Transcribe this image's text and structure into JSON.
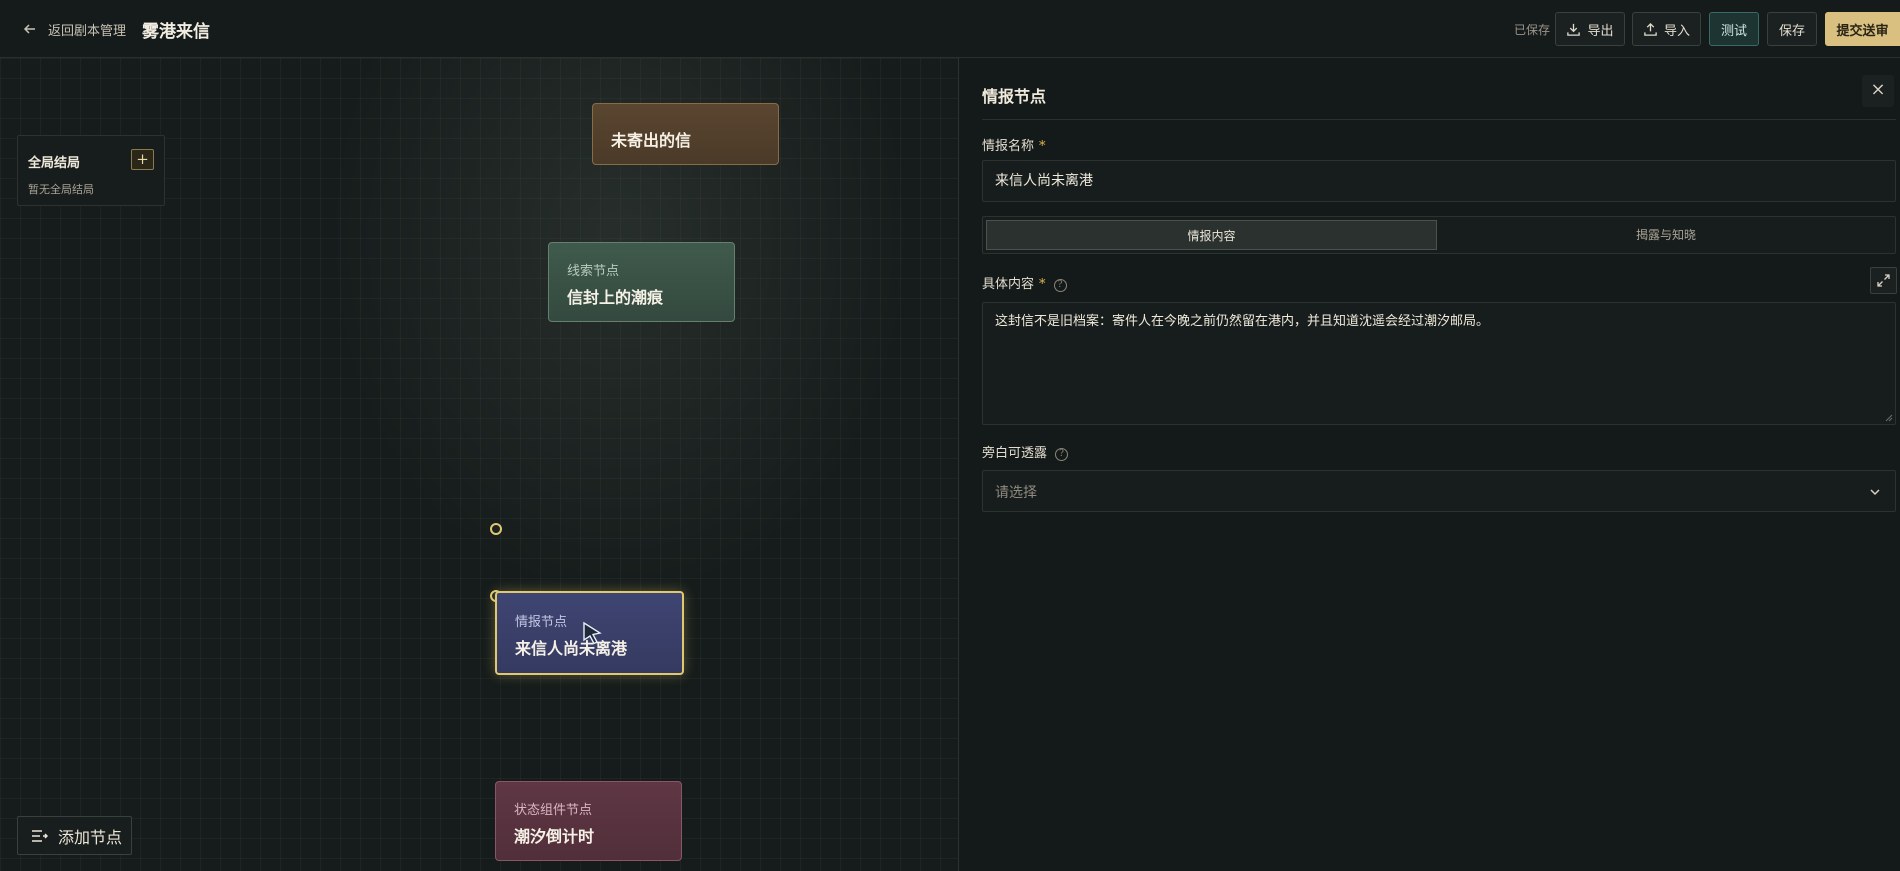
{
  "header": {
    "back_label": "返回剧本管理",
    "title": "雾港来信",
    "saved_status": "已保存",
    "export_label": "导出",
    "import_label": "导入",
    "test_label": "测试",
    "save_label": "保存",
    "submit_label": "提交送审"
  },
  "global_endings": {
    "title": "全局结局",
    "add_label": "+",
    "empty_text": "暂无全局结局"
  },
  "nodes": [
    {
      "type": "",
      "title": "未寄出的信",
      "color": "#5a4630"
    },
    {
      "type": "线索节点",
      "title": "信封上的潮痕",
      "color": "#3f5a4c"
    },
    {
      "type": "情报节点",
      "title": "来信人尚未离港",
      "color": "#3f4572",
      "selected": true
    },
    {
      "type": "状态组件节点",
      "title": "潮汐倒计时",
      "color": "#5f3744"
    }
  ],
  "add_node_label": "添加节点",
  "panel": {
    "title": "情报节点",
    "close_icon": "×",
    "name_label": "情报名称",
    "required_mark": "*",
    "name_value": "来信人尚未离港",
    "tabs": [
      "情报内容",
      "揭露与知晓"
    ],
    "content_label": "具体内容",
    "content_value": "这封信不是旧档案：寄件人在今晚之前仍然留在港内，并且知道沈遥会经过潮汐邮局。",
    "reveal_label": "旁白可透露",
    "reveal_placeholder": "请选择",
    "help_glyph": "?"
  },
  "colors": {
    "accent_gold": "#d9c081",
    "test_button": "#1d3433",
    "selection_outline": "#e0c870"
  }
}
